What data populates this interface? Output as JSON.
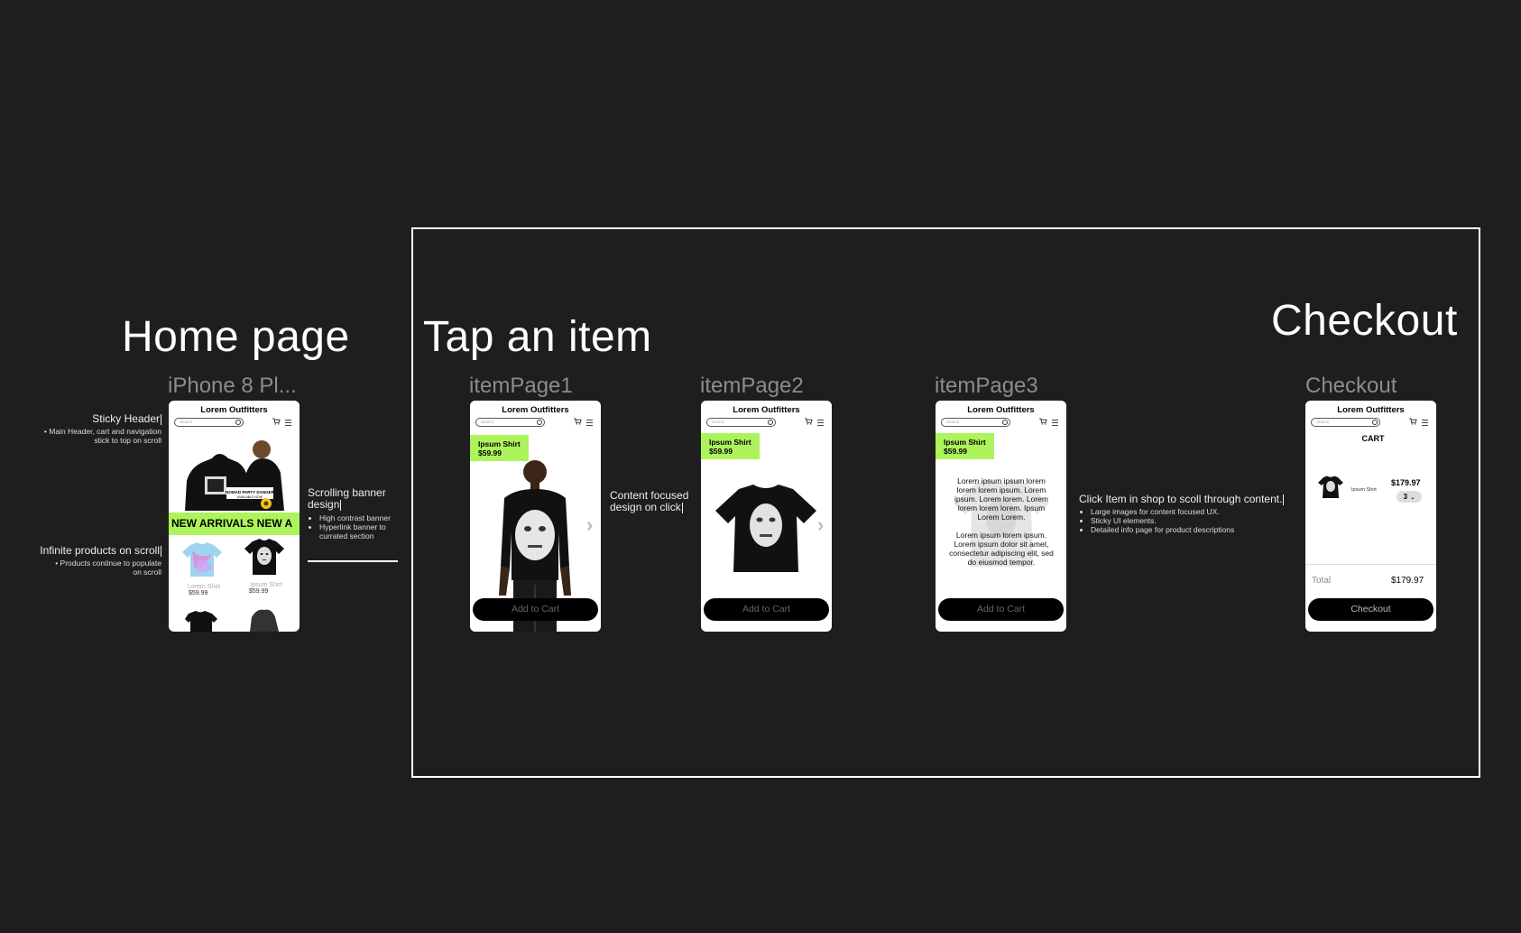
{
  "sections": {
    "home": "Home page",
    "tap": "Tap an item",
    "checkout": "Checkout"
  },
  "frames": {
    "home": "iPhone 8 Pl...",
    "item1": "itemPage1",
    "item2": "itemPage2",
    "item3": "itemPage3",
    "checkout": "Checkout"
  },
  "app": {
    "brand": "Lorem Outfitters",
    "search_placeholder": "Search",
    "accent": "#adf35c"
  },
  "home": {
    "banner": "NEW ARRIVALS NEW A",
    "products": [
      {
        "name": "Lorem Shirt",
        "price": "$59.99"
      },
      {
        "name": "Ipsum Shirt",
        "price": "$59.99"
      }
    ]
  },
  "item": {
    "name": "Ipsum Shirt",
    "price": "$59.99",
    "add_to_cart": "Add to Cart",
    "description_1": "Lorem ipsum ipsum lorem lorem lorem ipsum. Lorem ipsum. Lorem lorem. Lorem lorem lorem lorem. Ipsum Lorem Lorem.",
    "description_2": "Lorem ipsum lorem ipsum. Lorem ipsum dolor sit amet, consectetur adipiscing elit, sed do eiusmod tempor."
  },
  "checkout": {
    "heading": "CART",
    "item_name": "Ipsum Shirt",
    "item_price": "$179.97",
    "quantity": "3",
    "total_label": "Total",
    "total_value": "$179.97",
    "button": "Checkout"
  },
  "notes": {
    "sticky": {
      "title": "Sticky Header",
      "bullets": [
        "Main Header, cart and navigation stick to top on scroll"
      ]
    },
    "infinite": {
      "title": "Infinite products on scroll",
      "bullets": [
        "Products continue to populate on scroll"
      ]
    },
    "banner": {
      "title": "Scrolling banner design",
      "bullets": [
        "High contrast banner",
        "Hyperlink banner to currated section"
      ]
    },
    "content": {
      "title": "Content focused design on click"
    },
    "click": {
      "title": "Click Item in shop to scoll through content.",
      "bullets": [
        "Large images for content focused UX.",
        "Sticky UI elements.",
        "Detailed info page for product descriptions"
      ]
    }
  }
}
